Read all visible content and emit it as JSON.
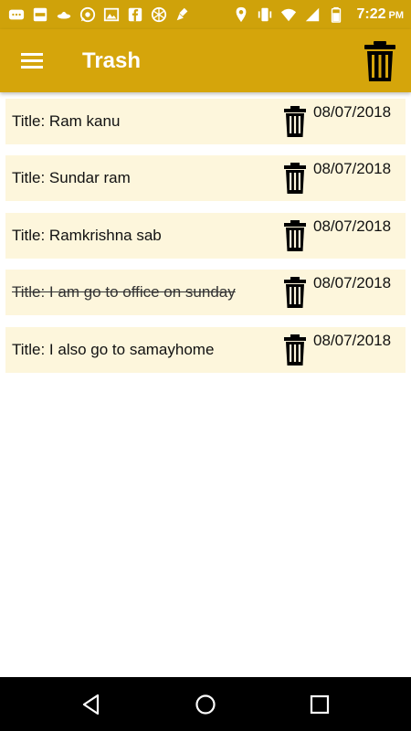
{
  "status_bar": {
    "time": "7:22",
    "ampm": "PM",
    "left_icons": [
      "chat-icon",
      "paytm-icon",
      "ufo-icon",
      "whatsapp-icon",
      "image-icon",
      "facebook-icon",
      "network-icon",
      "clean-icon"
    ],
    "right_icons": [
      "location-icon",
      "vibrate-icon",
      "wifi-icon",
      "signal-icon",
      "battery-icon"
    ]
  },
  "app_bar": {
    "title": "Trash",
    "color": "#d5a50b"
  },
  "notes": [
    {
      "title": "Title: Ram kanu",
      "date": "08/07/2018",
      "struck": false
    },
    {
      "title": "Title: Sundar ram",
      "date": "08/07/2018",
      "struck": false
    },
    {
      "title": "Title: Ramkrishna sab",
      "date": "08/07/2018",
      "struck": false
    },
    {
      "title": "Title: I am go to office on sunday",
      "date": "08/07/2018",
      "struck": true
    },
    {
      "title": "Title: I also go to samayhome",
      "date": "08/07/2018",
      "struck": false
    }
  ],
  "colors": {
    "card_background": "#fdf6dc",
    "status_bar": "#cfa20a"
  },
  "nav_bar": {
    "icons": [
      "back-icon",
      "home-icon",
      "recents-icon"
    ]
  }
}
